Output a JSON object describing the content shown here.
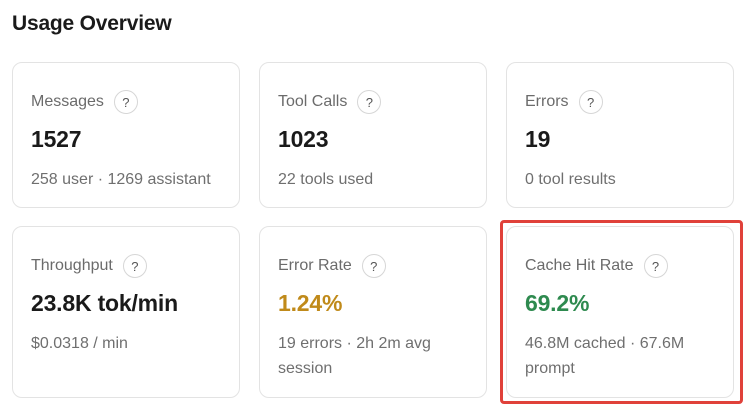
{
  "page": {
    "title": "Usage Overview"
  },
  "cards": [
    {
      "label": "Messages",
      "help": "?",
      "value": "1527",
      "sub": "258 user · 1269 assistant"
    },
    {
      "label": "Tool Calls",
      "help": "?",
      "value": "1023",
      "sub": "22 tools used"
    },
    {
      "label": "Errors",
      "help": "?",
      "value": "19",
      "sub": "0 tool results"
    },
    {
      "label": "Throughput",
      "help": "?",
      "value": "23.8K tok/min",
      "sub": "$0.0318 / min"
    },
    {
      "label": "Error Rate",
      "help": "?",
      "value": "1.24%",
      "sub": "19 errors · 2h 2m avg session",
      "value_color": "#c08a1a"
    },
    {
      "label": "Cache Hit Rate",
      "help": "?",
      "value": "69.2%",
      "sub": "46.8M cached · 67.6M prompt",
      "value_color": "#2e8a4f"
    }
  ],
  "highlight": {
    "color": "#e0413a"
  }
}
